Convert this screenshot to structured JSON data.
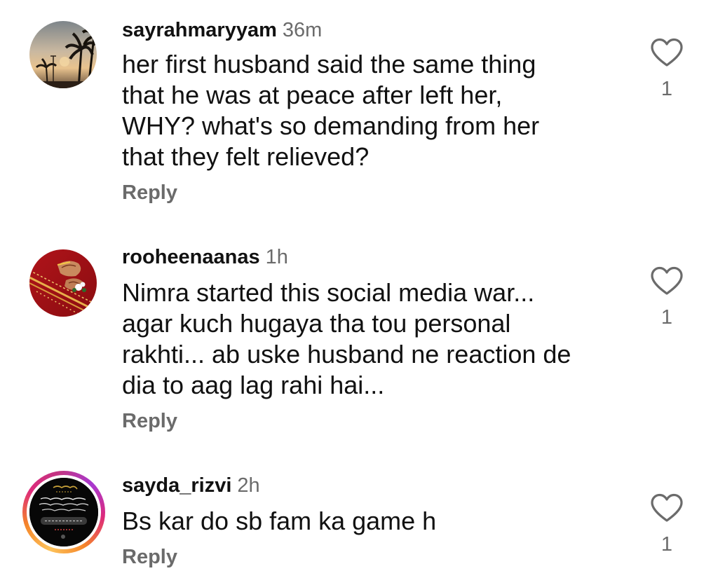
{
  "comments": [
    {
      "username": "sayrahmaryyam",
      "time": "36m",
      "lines": [
        "her first husband said the same thing",
        "that he was at peace after left her,",
        "WHY? what's so demanding from her",
        "that they felt relieved?"
      ],
      "reply_label": "Reply",
      "likes": "1",
      "avatar_icon": "sunset-palm-avatar"
    },
    {
      "username": "rooheenaanas",
      "time": "1h",
      "lines": [
        "Nimra started this social media war...",
        "agar kuch hugaya tha tou personal",
        "rakhti... ab uske husband ne reaction de",
        "dia to aag lag rahi hai..."
      ],
      "reply_label": "Reply",
      "likes": "1",
      "avatar_icon": "bridal-hands-avatar"
    },
    {
      "username": "sayda_rizvi",
      "time": "2h",
      "lines": [
        "Bs kar do sb fam ka game h"
      ],
      "reply_label": "Reply",
      "likes": "1",
      "avatar_icon": "calligraphy-avatar",
      "has_story_ring": true
    }
  ],
  "colors": {
    "text": "#111111",
    "secondary": "#6b6b6b",
    "background": "#ffffff"
  },
  "icons": {
    "like": "heart-outline-icon"
  }
}
